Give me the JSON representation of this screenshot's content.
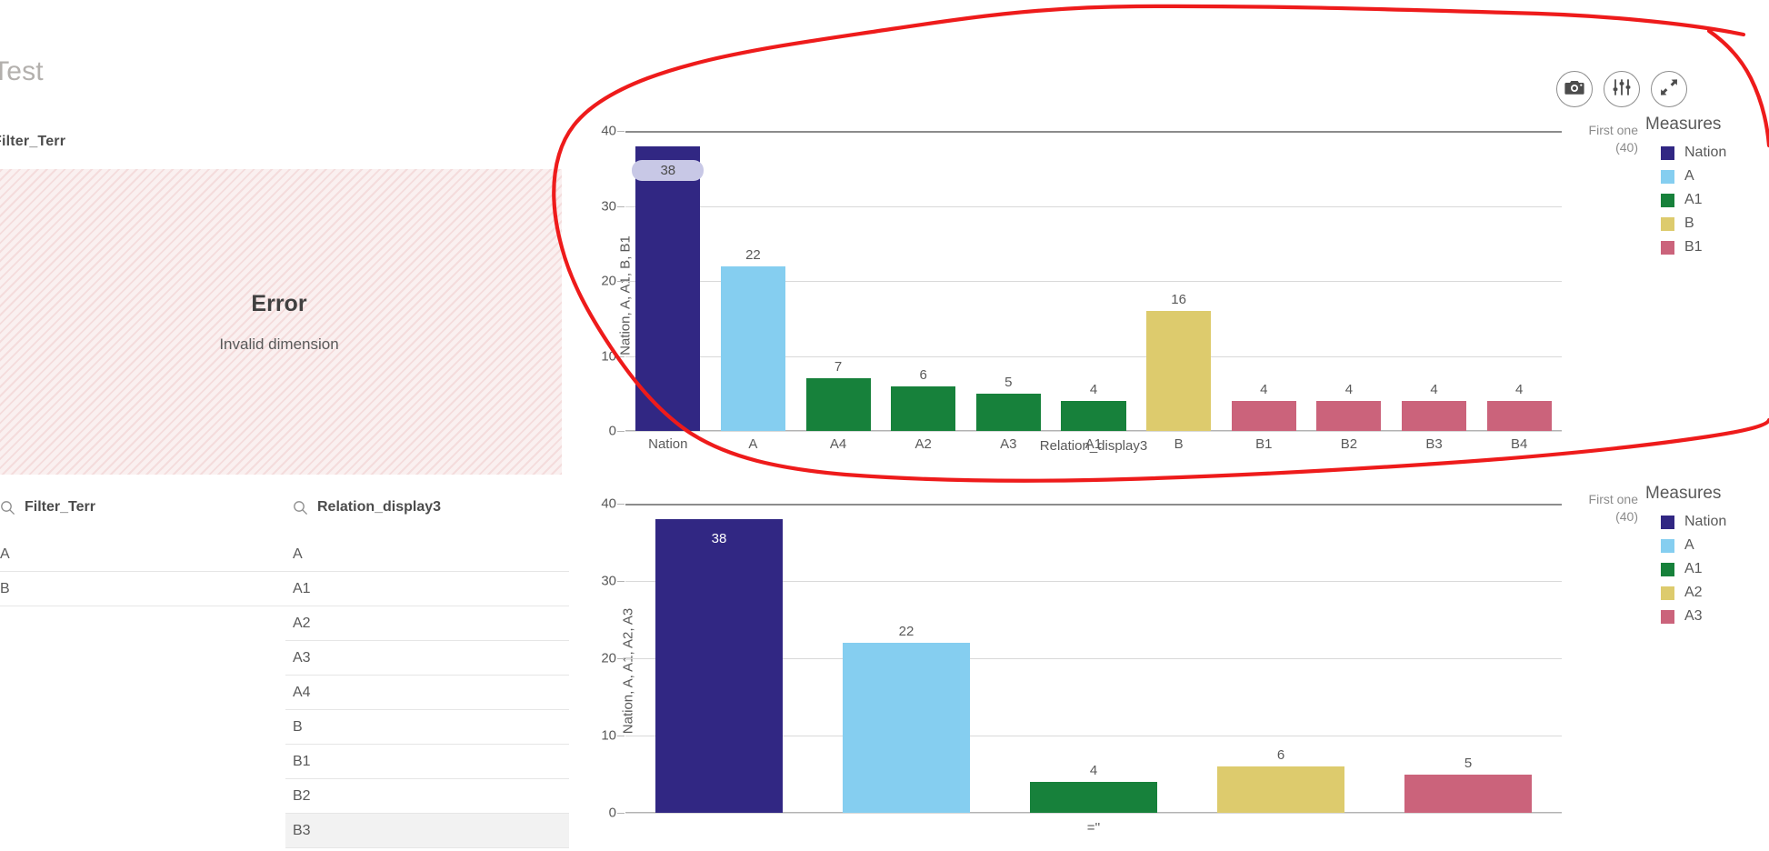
{
  "sheet": {
    "title": "Test"
  },
  "objects": {
    "filter_terr_title": "Filter_Terr",
    "error": {
      "title": "Error",
      "message": "Invalid dimension"
    }
  },
  "listboxes": [
    {
      "name": "Filter_Terr",
      "title": "Filter_Terr",
      "search_icon": "search-icon",
      "items": [
        "A",
        "B"
      ]
    },
    {
      "name": "Relation_display3",
      "title": "Relation_display3",
      "search_icon": "search-icon",
      "items": [
        "A",
        "A1",
        "A2",
        "A3",
        "A4",
        "B",
        "B1",
        "B2",
        "B3"
      ],
      "highlighted_item": "B3"
    }
  ],
  "toolbar": {
    "buttons": [
      {
        "name": "snapshot-button",
        "icon": "camera-icon",
        "label": "Snapshot"
      },
      {
        "name": "settings-button",
        "icon": "sliders-icon",
        "label": "Settings"
      },
      {
        "name": "fullscreen-button",
        "icon": "expand-icon",
        "label": "Fullscreen"
      }
    ]
  },
  "palette": {
    "nation": "#312783",
    "a": "#85cef0",
    "a1": "#17813b",
    "a2": "#ddcb6d",
    "a3": "#cb637b",
    "b": "#ddcb6d",
    "b1": "#cb637b",
    "grid": "#d9d9d9",
    "axis": "#8c8c8c",
    "annotation": "#ee1b1b",
    "selected_pill": "#c8c8e6"
  },
  "chart_data": [
    {
      "name": "top-chart",
      "type": "bar",
      "title": "",
      "xlabel": "Relation_display3",
      "ylabel": "Nation, A, A1, B, B1",
      "ylim": [
        0,
        40
      ],
      "yticks": [
        0,
        10,
        20,
        30,
        40
      ],
      "grid": true,
      "categories": [
        "Nation",
        "A",
        "A4",
        "A2",
        "A3",
        "A1",
        "B",
        "B1",
        "B2",
        "B3",
        "B4"
      ],
      "values": [
        38,
        22,
        7,
        6,
        5,
        4,
        16,
        4,
        4,
        4,
        4
      ],
      "colors": [
        "#312783",
        "#85cef0",
        "#17813b",
        "#17813b",
        "#17813b",
        "#17813b",
        "#ddcb6d",
        "#cb637b",
        "#cb637b",
        "#cb637b",
        "#cb637b"
      ],
      "selected_index": 0,
      "legend": {
        "position": "right",
        "title": "Measures",
        "note": "First one\n(40)",
        "note_line1": "First one",
        "note_line2": "(40)",
        "entries": [
          {
            "label": "Nation",
            "color": "#312783"
          },
          {
            "label": "A",
            "color": "#85cef0"
          },
          {
            "label": "A1",
            "color": "#17813b"
          },
          {
            "label": "B",
            "color": "#ddcb6d"
          },
          {
            "label": "B1",
            "color": "#cb637b"
          }
        ]
      }
    },
    {
      "name": "bottom-chart",
      "type": "bar",
      "title": "",
      "xlabel": "=''",
      "ylabel": "Nation, A, A1, A2, A3",
      "ylim": [
        0,
        40
      ],
      "yticks": [
        0,
        10,
        20,
        30,
        40
      ],
      "grid": true,
      "categories": [
        "",
        "",
        "",
        "",
        ""
      ],
      "values": [
        38,
        22,
        4,
        6,
        5
      ],
      "colors": [
        "#312783",
        "#85cef0",
        "#17813b",
        "#ddcb6d",
        "#cb637b"
      ],
      "legend": {
        "position": "right",
        "title": "Measures",
        "note_line1": "First one",
        "note_line2": "(40)",
        "entries": [
          {
            "label": "Nation",
            "color": "#312783"
          },
          {
            "label": "A",
            "color": "#85cef0"
          },
          {
            "label": "A1",
            "color": "#17813b"
          },
          {
            "label": "A2",
            "color": "#ddcb6d"
          },
          {
            "label": "A3",
            "color": "#cb637b"
          }
        ]
      }
    }
  ]
}
